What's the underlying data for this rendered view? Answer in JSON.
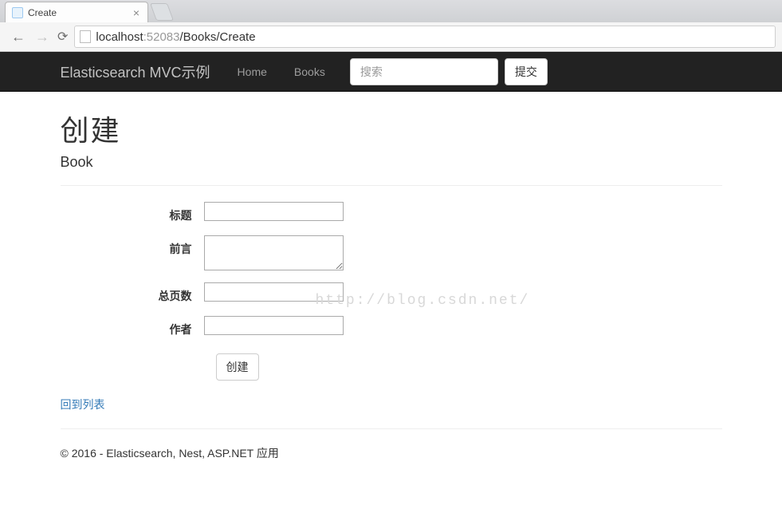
{
  "browser": {
    "tab_title": "Create",
    "url_host": "localhost",
    "url_port": ":52083",
    "url_path": "/Books/Create"
  },
  "navbar": {
    "brand": "Elasticsearch MVC示例",
    "links": [
      "Home",
      "Books"
    ],
    "search_placeholder": "搜索",
    "submit_label": "提交"
  },
  "page": {
    "title": "创建",
    "subtitle": "Book"
  },
  "form": {
    "fields": {
      "title": {
        "label": "标题",
        "value": ""
      },
      "preface": {
        "label": "前言",
        "value": ""
      },
      "pages": {
        "label": "总页数",
        "value": ""
      },
      "author": {
        "label": "作者",
        "value": ""
      }
    },
    "submit_label": "创建"
  },
  "back_link": "回到列表",
  "footer": "© 2016 - Elasticsearch, Nest, ASP.NET 应用",
  "watermark": "http://blog.csdn.net/"
}
